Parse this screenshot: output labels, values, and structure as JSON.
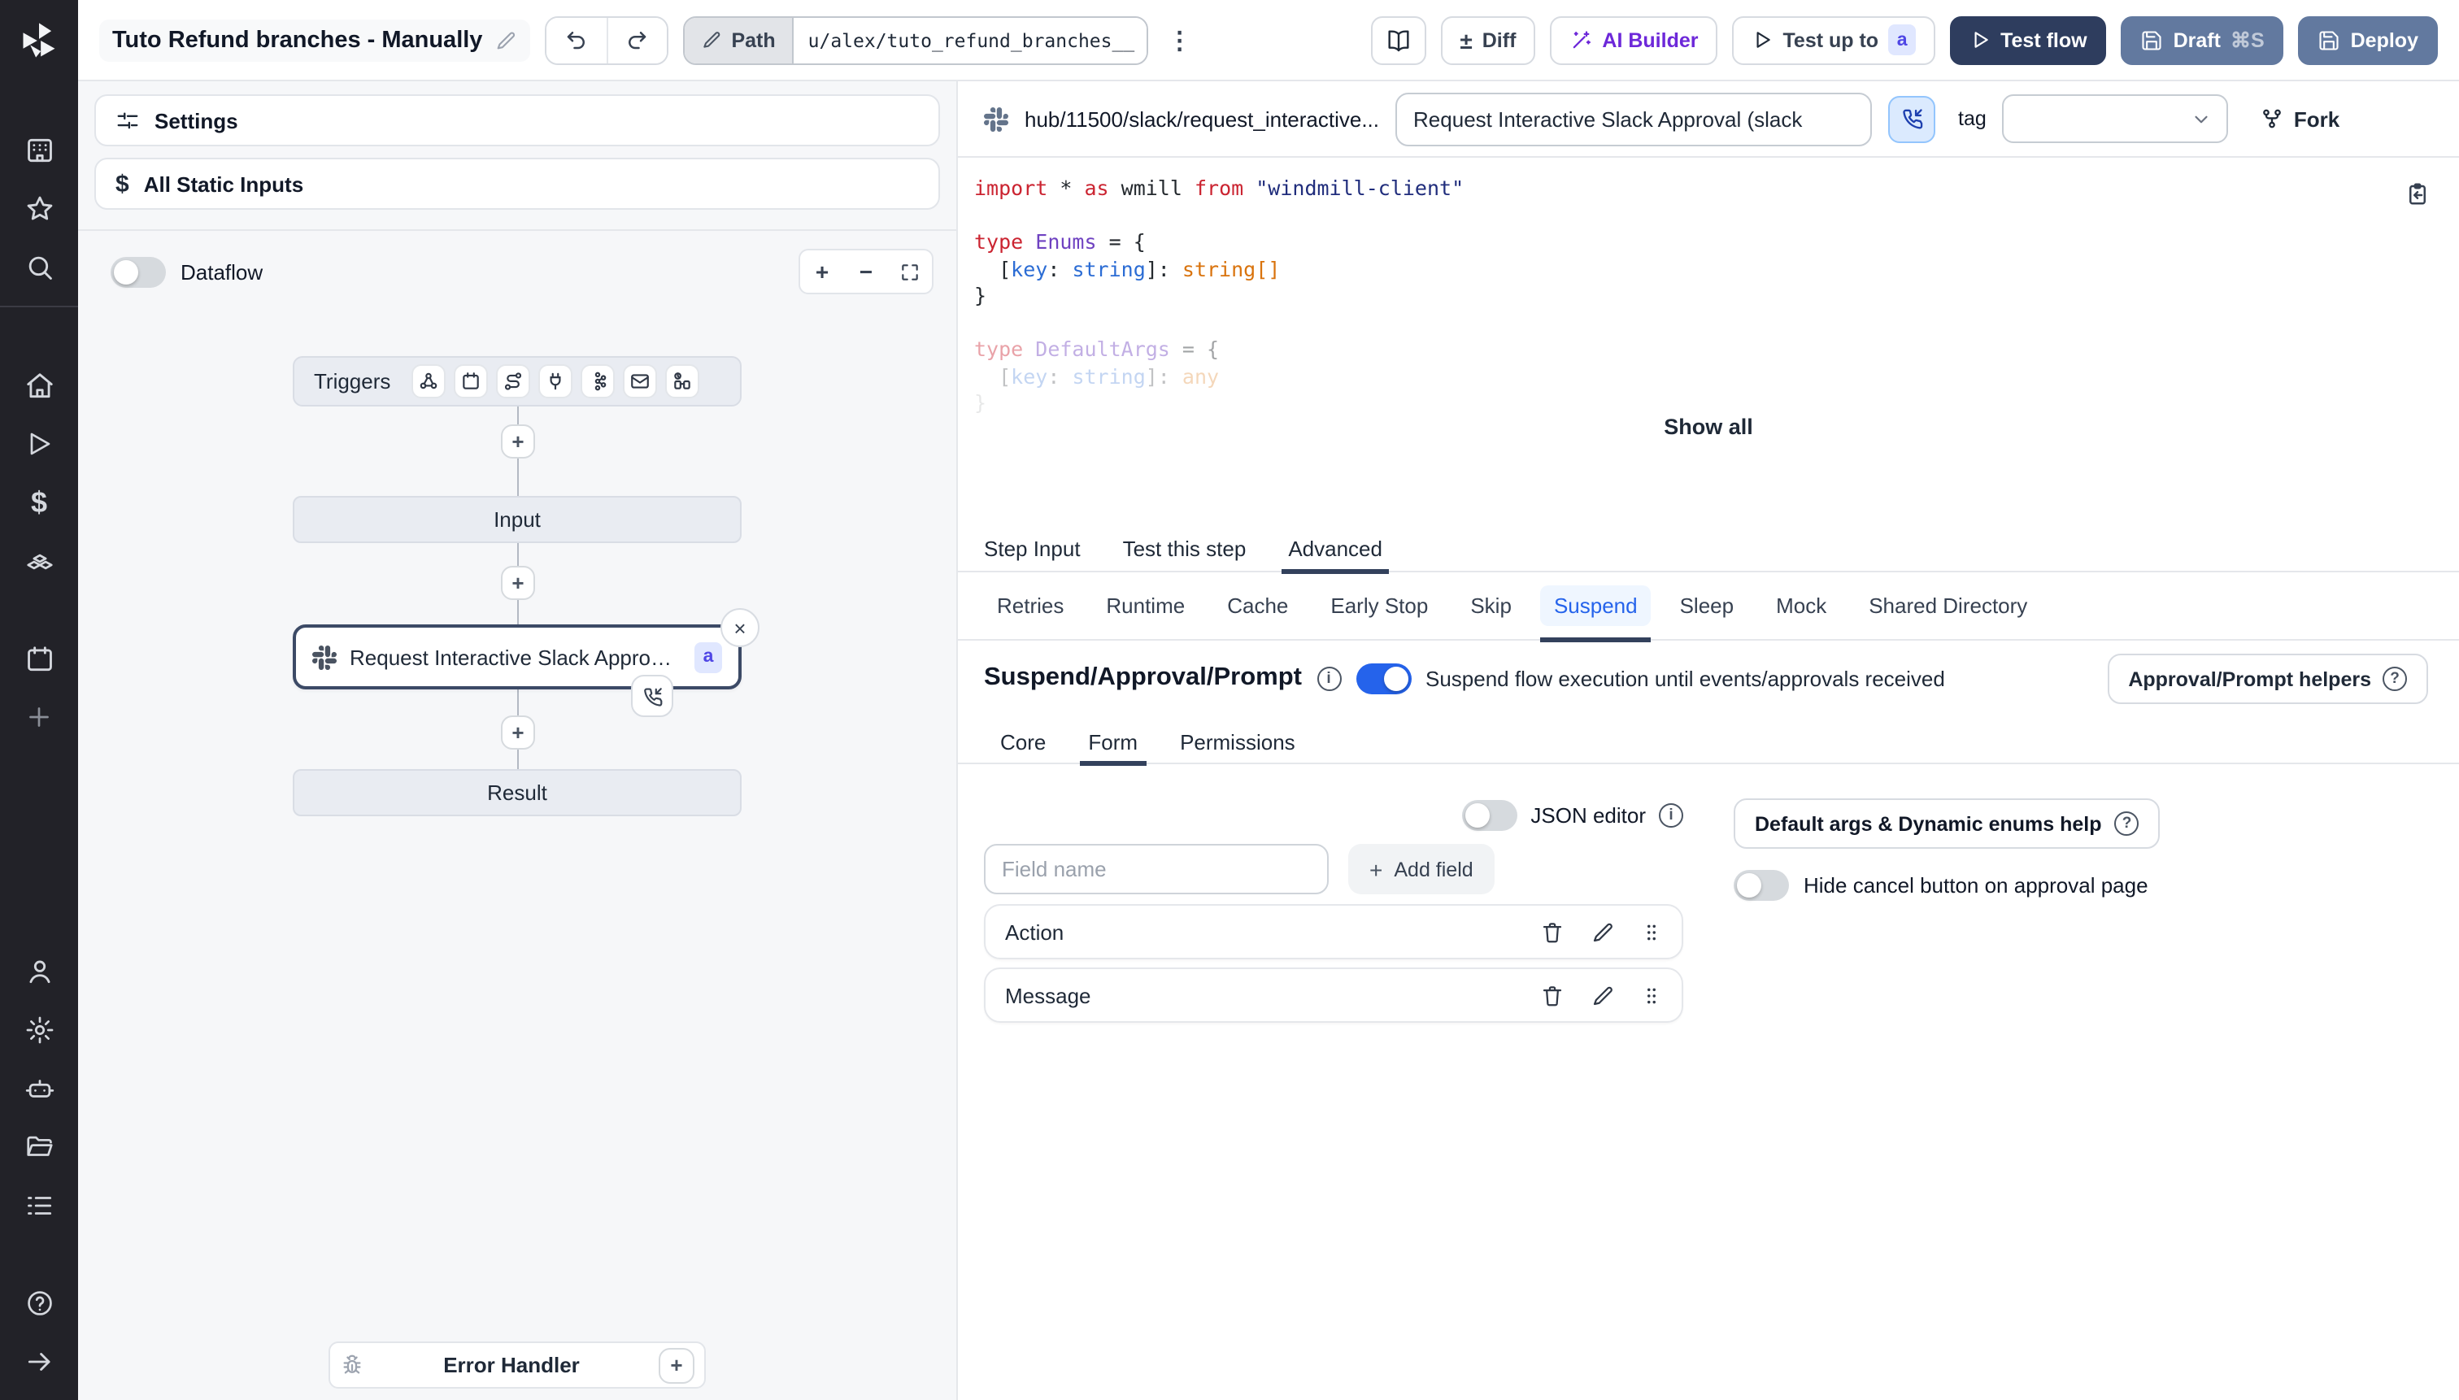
{
  "topbar": {
    "title": "Tuto Refund branches - Manually",
    "path_label": "Path",
    "path_value": "u/alex/tuto_refund_branches__",
    "diff_label": "Diff",
    "ai_builder_label": "AI Builder",
    "test_up_to_label": "Test up to",
    "test_up_to_badge": "a",
    "test_flow_label": "Test flow",
    "draft_label": "Draft",
    "draft_shortcut": "⌘S",
    "deploy_label": "Deploy"
  },
  "sidebar": {
    "icons": [
      "windmill-logo",
      "workspace-icon",
      "favorites-icon",
      "search-icon",
      "home-icon",
      "runs-icon",
      "variables-icon",
      "resources-icon",
      "schedules-icon",
      "add-icon",
      "users-icon",
      "settings-icon",
      "workers-icon",
      "folders-icon",
      "logs-icon",
      "help-icon",
      "collapse-icon"
    ]
  },
  "flow_panel": {
    "settings_label": "Settings",
    "static_inputs_label": "All Static Inputs",
    "dataflow_label": "Dataflow",
    "graph": {
      "triggers_label": "Triggers",
      "trigger_icons": [
        "webhook-icon",
        "schedule-icon",
        "route-icon",
        "websocket-icon",
        "kafka-icon",
        "email-icon",
        "poll-icon"
      ],
      "input_label": "Input",
      "step_label": "Request Interactive Slack Approval (...",
      "step_badge": "a",
      "result_label": "Result",
      "error_handler_label": "Error Handler"
    }
  },
  "step_panel": {
    "hub_path": "hub/11500/slack/request_interactive...",
    "name_value": "Request Interactive Slack Approval (slack",
    "tag_label": "tag",
    "tag_value": "",
    "fork_label": "Fork",
    "show_all_label": "Show all",
    "tabs": [
      "Step Input",
      "Test this step",
      "Advanced"
    ],
    "selected_tab": "Advanced",
    "subtabs": [
      "Retries",
      "Runtime",
      "Cache",
      "Early Stop",
      "Skip",
      "Suspend",
      "Sleep",
      "Mock",
      "Shared Directory"
    ],
    "selected_subtab": "Suspend",
    "suspend": {
      "heading": "Suspend/Approval/Prompt",
      "toggle_text": "Suspend flow execution until events/approvals received",
      "helpers_button": "Approval/Prompt helpers",
      "form_tabs": [
        "Core",
        "Form",
        "Permissions"
      ],
      "selected_form_tab": "Form",
      "json_editor_label": "JSON editor",
      "field_placeholder": "Field name",
      "add_field_label": "Add field",
      "fields": [
        "Action",
        "Message"
      ],
      "default_args_button": "Default args & Dynamic enums help",
      "hide_cancel_label": "Hide cancel button on approval page"
    }
  },
  "code": {
    "lines": [
      {
        "fade": 1,
        "tokens": [
          {
            "c": "kw",
            "t": "import"
          },
          {
            "c": "pl",
            "t": " * "
          },
          {
            "c": "kw",
            "t": "as"
          },
          {
            "c": "pl",
            "t": " wmill "
          },
          {
            "c": "kw",
            "t": "from"
          },
          {
            "c": "pl",
            "t": " "
          },
          {
            "c": "str",
            "t": "\"windmill-client\""
          }
        ]
      },
      {
        "fade": 1,
        "tokens": []
      },
      {
        "fade": 1,
        "tokens": [
          {
            "c": "kw",
            "t": "type"
          },
          {
            "c": "pl",
            "t": " "
          },
          {
            "c": "type",
            "t": "Enums"
          },
          {
            "c": "pl",
            "t": " = {"
          }
        ]
      },
      {
        "fade": 1,
        "tokens": [
          {
            "c": "pl",
            "t": "  ["
          },
          {
            "c": "var",
            "t": "key"
          },
          {
            "c": "pl",
            "t": ": "
          },
          {
            "c": "var",
            "t": "string"
          },
          {
            "c": "pl",
            "t": "]: "
          },
          {
            "c": "orange",
            "t": "string[]"
          }
        ]
      },
      {
        "fade": 1,
        "tokens": [
          {
            "c": "pl",
            "t": "}"
          }
        ]
      },
      {
        "fade": 1,
        "tokens": []
      },
      {
        "fade": 0.42,
        "tokens": [
          {
            "c": "kw",
            "t": "type"
          },
          {
            "c": "pl",
            "t": " "
          },
          {
            "c": "type",
            "t": "DefaultArgs"
          },
          {
            "c": "pl",
            "t": " = {"
          }
        ]
      },
      {
        "fade": 0.28,
        "tokens": [
          {
            "c": "pl",
            "t": "  ["
          },
          {
            "c": "var",
            "t": "key"
          },
          {
            "c": "pl",
            "t": ": "
          },
          {
            "c": "var",
            "t": "string"
          },
          {
            "c": "pl",
            "t": "]: "
          },
          {
            "c": "orange",
            "t": "any"
          }
        ]
      },
      {
        "fade": 0.1,
        "tokens": [
          {
            "c": "pl",
            "t": "}"
          }
        ]
      }
    ]
  }
}
